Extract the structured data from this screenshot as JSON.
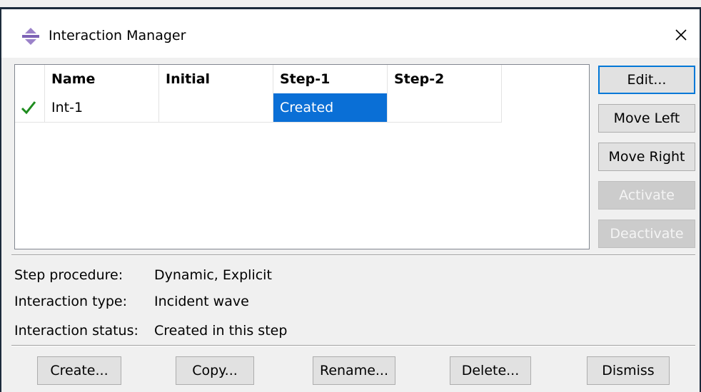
{
  "window": {
    "title": "Interaction Manager",
    "icon": "interaction-manager-icon",
    "close_icon": "close-icon"
  },
  "table": {
    "columns": [
      "",
      "Name",
      "Initial",
      "Step-1",
      "Step-2"
    ],
    "rows": [
      {
        "status_icon": "green-checkmark-icon",
        "name": "Int-1",
        "initial": "",
        "step1": "Created",
        "step2": "",
        "selected_cell": "step1"
      }
    ]
  },
  "side_buttons": {
    "edit": "Edit...",
    "move_left": "Move Left",
    "move_right": "Move Right",
    "activate": "Activate",
    "deactivate": "Deactivate"
  },
  "info": {
    "step_procedure_label": "Step procedure:",
    "step_procedure_value": "Dynamic, Explicit",
    "interaction_type_label": "Interaction type:",
    "interaction_type_value": "Incident wave",
    "interaction_status_label": "Interaction status:",
    "interaction_status_value": "Created in this step"
  },
  "bottom_buttons": {
    "create": "Create...",
    "copy": "Copy...",
    "rename": "Rename...",
    "delete": "Delete...",
    "dismiss": "Dismiss"
  },
  "colors": {
    "selection": "#0a6fd6",
    "check": "#1e8c1e",
    "default_button_border": "#0078d7",
    "window_border": "#1c2b3c"
  }
}
